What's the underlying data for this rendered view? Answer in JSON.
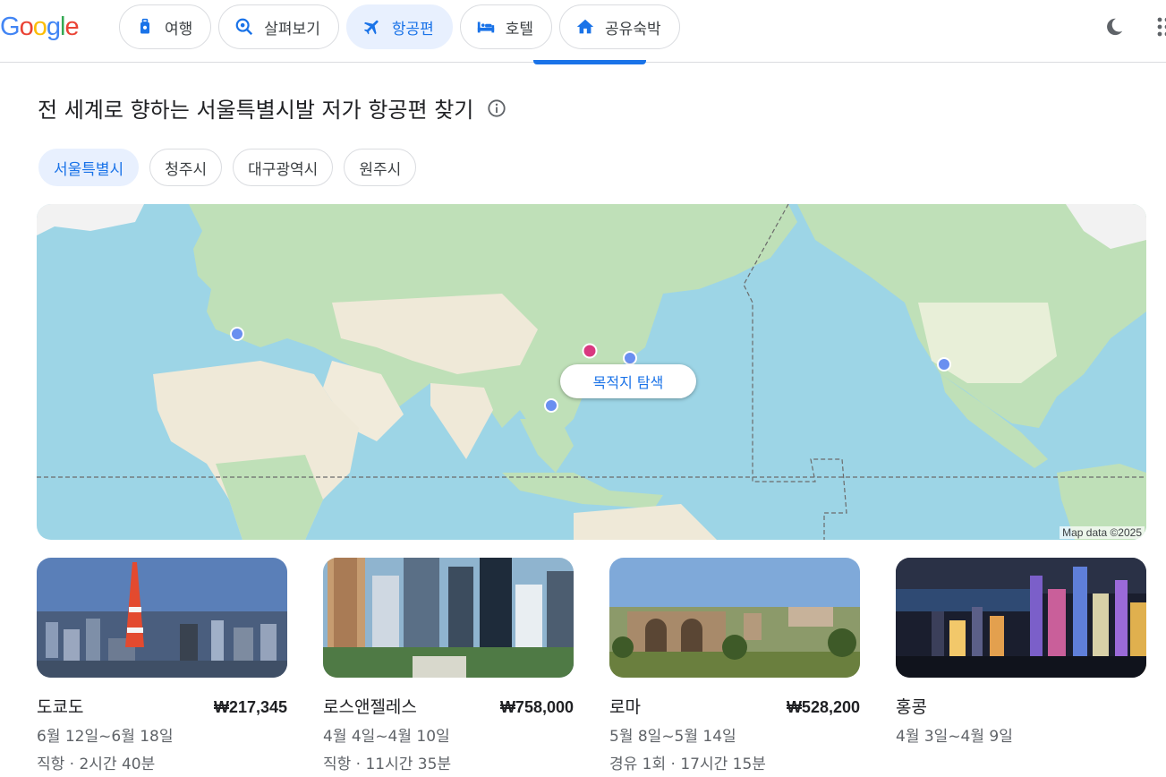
{
  "header": {
    "logo": "Google",
    "tabs": [
      {
        "label": "여행",
        "icon": "luggage-icon",
        "active": false
      },
      {
        "label": "살펴보기",
        "icon": "explore-icon",
        "active": false
      },
      {
        "label": "항공편",
        "icon": "airplane-icon",
        "active": true
      },
      {
        "label": "호텔",
        "icon": "bed-icon",
        "active": false
      },
      {
        "label": "공유숙박",
        "icon": "home-icon",
        "active": false
      }
    ],
    "theme_icon": "moon-icon",
    "apps_icon": "apps-grid-icon"
  },
  "title": "전 세계로 향하는 서울특별시발 저가 항공편 찾기",
  "origin_chips": [
    {
      "label": "서울특별시",
      "selected": true
    },
    {
      "label": "청주시",
      "selected": false
    },
    {
      "label": "대구광역시",
      "selected": false
    },
    {
      "label": "원주시",
      "selected": false
    }
  ],
  "map": {
    "explore_button": "목적지 탐색",
    "credit": "Map data ©2025"
  },
  "destinations": [
    {
      "name": "도쿄도",
      "price": "₩217,345",
      "dates": "6월 12일~6월 18일",
      "flight": "직항 · 2시간 40분"
    },
    {
      "name": "로스앤젤레스",
      "price": "₩758,000",
      "dates": "4월 4일~4월 10일",
      "flight": "직항 · 11시간 35분"
    },
    {
      "name": "로마",
      "price": "₩528,200",
      "dates": "5월 8일~5월 14일",
      "flight": "경유 1회 · 17시간 15분"
    },
    {
      "name": "홍콩",
      "price": "",
      "dates": "4월 3일~4월 9일",
      "flight": ""
    }
  ],
  "colors": {
    "accent": "#1a73e8",
    "origin_pin": "#d93880",
    "destination_pin": "#6a8ff0"
  }
}
